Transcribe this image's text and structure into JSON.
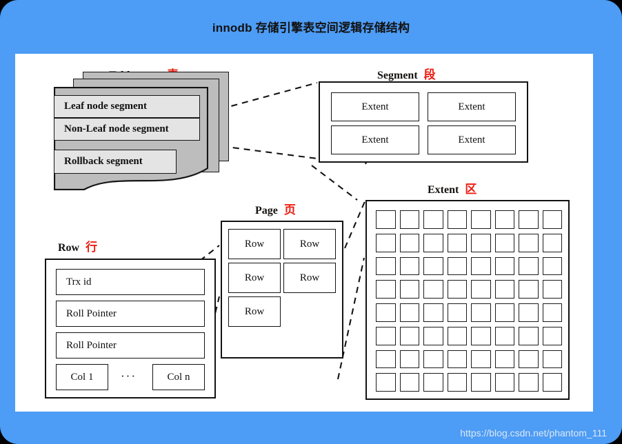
{
  "header": {
    "title": "innodb 存储引擎表空间逻辑存储结构",
    "background_color": "#4d9cf5",
    "text_color": "#111111"
  },
  "watermark": {
    "text": "https://blog.csdn.net/phantom_111"
  },
  "accent": {
    "chinese_label_color": "#ee1c11",
    "sheet_fill": "#bdbdbd",
    "segment_fill": "#e4e4e4",
    "stroke": "#121212"
  },
  "sections": {
    "tablespace": {
      "label_en": "Tablespace",
      "label_cn": "表",
      "sheet_count": 3,
      "segments": [
        "Leaf node segment",
        "Non-Leaf node segment",
        "Rollback segment"
      ]
    },
    "segment": {
      "label_en": "Segment",
      "label_cn": "段",
      "extents": [
        "Extent",
        "Extent",
        "Extent",
        "Extent"
      ]
    },
    "extent": {
      "label_en": "Extent",
      "label_cn": "区",
      "grid_rows": 8,
      "grid_cols": 8,
      "page_count": 64
    },
    "page": {
      "label_en": "Page",
      "label_cn": "页",
      "rows": [
        "Row",
        "Row",
        "Row",
        "Row",
        "Row"
      ]
    },
    "row": {
      "label_en": "Row",
      "label_cn": "行",
      "fields": [
        "Trx id",
        "Roll Pointer",
        "Roll Pointer"
      ],
      "col_first": "Col 1",
      "col_ellipsis": "···",
      "col_last": "Col n"
    }
  }
}
